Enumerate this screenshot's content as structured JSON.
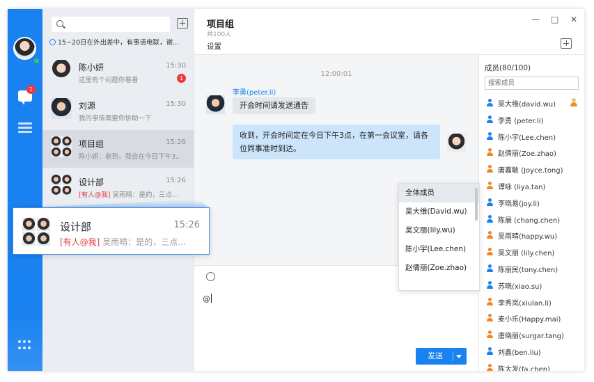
{
  "rail": {
    "chat_badge": "1"
  },
  "search": {
    "placeholder": ""
  },
  "notice": "15~20日在外出差中，有事请电联，谢...",
  "conversations": [
    {
      "name": "陈小妍",
      "time": "15:30",
      "message": "这里有个问题你看看",
      "badge": "1",
      "avatar": "girl"
    },
    {
      "name": "刘源",
      "time": "15:30",
      "message": "我的事情需要你协助一下",
      "avatar": "man"
    },
    {
      "name": "项目组",
      "time": "15:26",
      "message": "陈小妍：收到，我会在今日下午3...",
      "avatar": "grid"
    },
    {
      "name": "设计部",
      "time": "15:26",
      "mention": "[有人@我]",
      "message": "吴雨晴：是的，三点...",
      "avatar": "grid"
    }
  ],
  "float_card": {
    "name": "设计部",
    "time": "15:26",
    "mention": "[有人@我]",
    "message": "吴雨晴：是的，三点..."
  },
  "chat": {
    "title": "项目组",
    "subtitle": "共100人",
    "settings": "设置",
    "window_buttons": [
      "—",
      "□",
      "✕"
    ],
    "timestamp": "12:00:01",
    "sender": "李勇(peter.li)",
    "left_message": "开会时间请发送通告",
    "right_message": "收到，开会时间定在今日下午3点，在第一会议室，请各位同事准时到达。",
    "input_text": "@",
    "send_label": "发送"
  },
  "mention_popup": {
    "options": [
      "全体成员",
      "吴大维(David.wu)",
      "吴文丽(lily.wu)",
      "陈小宇(Lee.chen)",
      "赵倩丽(Zoe.zhao)"
    ]
  },
  "members": {
    "title": "成员(80/100)",
    "search_placeholder": "搜索成员",
    "list": [
      {
        "name": "吴大维(david.wu)",
        "color": "blue",
        "owner": true
      },
      {
        "name": "李勇 (peter.li)",
        "color": "blue"
      },
      {
        "name": "陈小宇(Lee.chen)",
        "color": "blue"
      },
      {
        "name": "赵倩丽(Zoe.zhao)",
        "color": "orange"
      },
      {
        "name": "唐嘉敏 (Joyce.tong)",
        "color": "orange"
      },
      {
        "name": "谭咏 (Iiya.tan)",
        "color": "orange"
      },
      {
        "name": "李晓易(joy.li)",
        "color": "blue"
      },
      {
        "name": "陈晨 (chang.chen)",
        "color": "blue"
      },
      {
        "name": "吴雨晴(happy.wu)",
        "color": "orange"
      },
      {
        "name": "吴文丽 (lily.chen)",
        "color": "orange"
      },
      {
        "name": "陈丽民(tony.chen)",
        "color": "blue"
      },
      {
        "name": "苏晓(xiao.su)",
        "color": "blue"
      },
      {
        "name": "李秀岚(xiulan.li)",
        "color": "orange"
      },
      {
        "name": "麦小乐(Happy.mai)",
        "color": "orange"
      },
      {
        "name": "唐晓丽(surgar.tang)",
        "color": "orange"
      },
      {
        "name": "刘鑫(ben.liu)",
        "color": "blue"
      },
      {
        "name": "陈大发(fa.chen)",
        "color": "orange"
      }
    ]
  }
}
